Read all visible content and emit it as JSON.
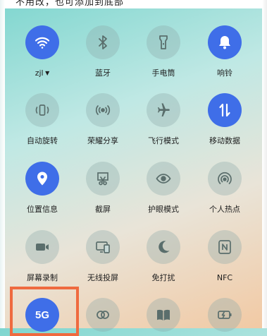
{
  "top_text": "不用改，也可添加到底部",
  "rows": [
    [
      {
        "label": "zjl",
        "icon": "wifi-icon",
        "active": true,
        "has_caret": true
      },
      {
        "label": "蓝牙",
        "icon": "bluetooth-icon",
        "active": false
      },
      {
        "label": "手电筒",
        "icon": "flashlight-icon",
        "active": false
      },
      {
        "label": "响铃",
        "icon": "bell-icon",
        "active": true
      }
    ],
    [
      {
        "label": "自动旋转",
        "icon": "auto-rotate-icon",
        "active": false
      },
      {
        "label": "荣耀分享",
        "icon": "share-icon",
        "active": false
      },
      {
        "label": "飞行模式",
        "icon": "airplane-icon",
        "active": false
      },
      {
        "label": "移动数据",
        "icon": "mobile-data-icon",
        "active": true
      }
    ],
    [
      {
        "label": "位置信息",
        "icon": "location-icon",
        "active": true
      },
      {
        "label": "截屏",
        "icon": "screenshot-icon",
        "active": false
      },
      {
        "label": "护眼模式",
        "icon": "eye-icon",
        "active": false
      },
      {
        "label": "个人热点",
        "icon": "hotspot-icon",
        "active": false
      }
    ],
    [
      {
        "label": "屏幕录制",
        "icon": "screen-record-icon",
        "active": false
      },
      {
        "label": "无线投屏",
        "icon": "wireless-projection-icon",
        "active": false
      },
      {
        "label": "免打扰",
        "icon": "moon-icon",
        "active": false
      },
      {
        "label": "NFC",
        "icon": "nfc-icon",
        "active": false
      }
    ],
    [
      {
        "label": "",
        "icon": "5g-icon",
        "text": "5G",
        "active": true
      },
      {
        "label": "",
        "icon": "ultra-power-icon",
        "active": false
      },
      {
        "label": "",
        "icon": "book-icon",
        "active": false
      },
      {
        "label": "",
        "icon": "battery-saver-icon",
        "active": false
      }
    ]
  ],
  "colors": {
    "active": "#3f6ee8",
    "highlight": "#ef6a3f"
  }
}
